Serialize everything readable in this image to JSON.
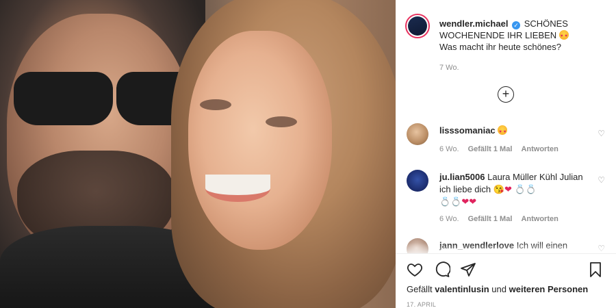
{
  "post": {
    "username": "wendler.michael",
    "caption_line1": "SCHÖNES",
    "caption_line2": "WOCHENENDE IHR LIEBEN",
    "caption_line3": "Was macht ihr heute schönes?",
    "time": "7 Wo.",
    "load_more_symbol": "+"
  },
  "comments": [
    {
      "username": "lisssomaniac",
      "text": "",
      "time": "6 Wo.",
      "likes": "Gefällt 1 Mal",
      "reply": "Antworten"
    },
    {
      "username": "ju.lian5006",
      "text": "Laura Müller Kühl Julian ich liebe dich",
      "time": "6 Wo.",
      "likes": "Gefällt 1 Mal",
      "reply": "Antworten"
    },
    {
      "username": "jann_wendlerlove",
      "text": "Ich will einen"
    }
  ],
  "footer": {
    "likes_prefix": "Gefällt",
    "likes_user": "valentinlusin",
    "likes_middle": "und",
    "likes_suffix": "weiteren Personen",
    "date": "17. APRIL"
  },
  "icons": {
    "like": "heart-outline-icon",
    "comment": "comment-bubble-icon",
    "share": "paper-plane-icon",
    "save": "bookmark-icon"
  }
}
